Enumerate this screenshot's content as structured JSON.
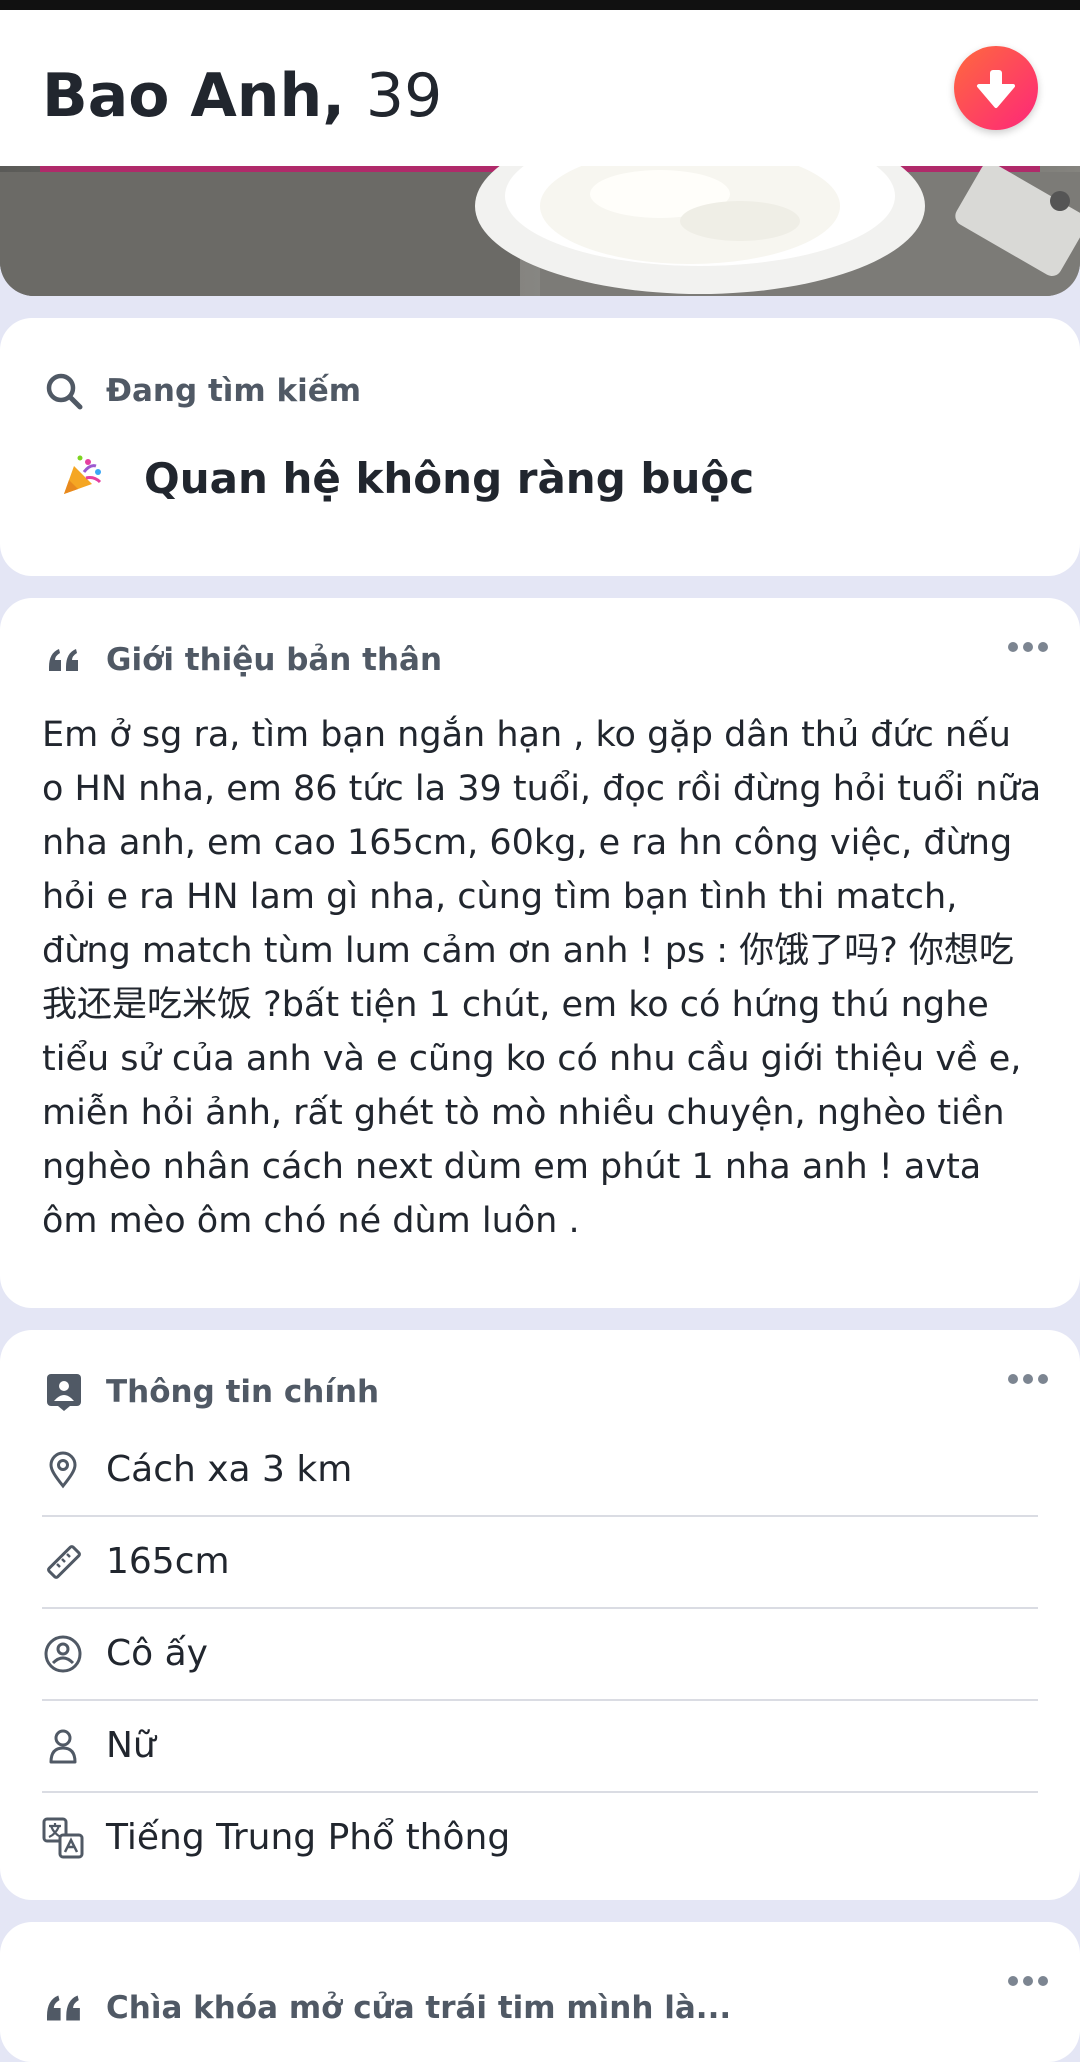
{
  "header": {
    "name": "Bao Anh,",
    "age": "39",
    "collapse_icon": "arrow-down-icon",
    "accent_gradient": [
      "#ff6a3d",
      "#fd267a"
    ]
  },
  "looking_for": {
    "title": "Đang tìm kiếm",
    "icon": "search-icon",
    "value_icon": "party-popper-icon",
    "value": "Quan hệ không ràng buộc"
  },
  "about": {
    "title": "Giới thiệu bản thân",
    "icon": "quote-icon",
    "more_icon": "more-icon",
    "text": "Em ở sg ra, tìm bạn ngắn hạn , ko gặp dân thủ đức nếu o HN nha, em 86 tức la 39 tuổi, đọc rồi đừng hỏi tuổi nữa nha anh, em cao 165cm, 60kg, e ra hn công việc, đừng hỏi e ra HN lam gì nha, cùng tìm bạn tình thi match, đừng match tùm lum cảm ơn anh ! ps : 你饿了吗? 你想吃我还是吃米饭 ?bất tiện 1 chút, em ko có hứng thú nghe tiểu sử của anh và e cũng ko có nhu cầu giới thiệu về e, miễn hỏi ảnh, rất ghét tò mò nhiều chuyện, nghèo tiền nghèo nhân cách next dùm em phút 1 nha anh ! avta ôm mèo ôm chó né dùm luôn ."
  },
  "essentials": {
    "title": "Thông tin chính",
    "icon": "profile-card-icon",
    "more_icon": "more-icon",
    "items": [
      {
        "icon": "location-pin-icon",
        "label": "Cách xa 3 km"
      },
      {
        "icon": "ruler-icon",
        "label": "165cm"
      },
      {
        "icon": "pronoun-icon",
        "label": "Cô ấy"
      },
      {
        "icon": "person-icon",
        "label": "Nữ"
      },
      {
        "icon": "translate-icon",
        "label": "Tiếng Trung Phổ thông"
      }
    ]
  },
  "prompt": {
    "title": "Chìa khóa mở cửa trái tim mình là...",
    "icon": "quote-icon",
    "more_icon": "more-icon"
  }
}
